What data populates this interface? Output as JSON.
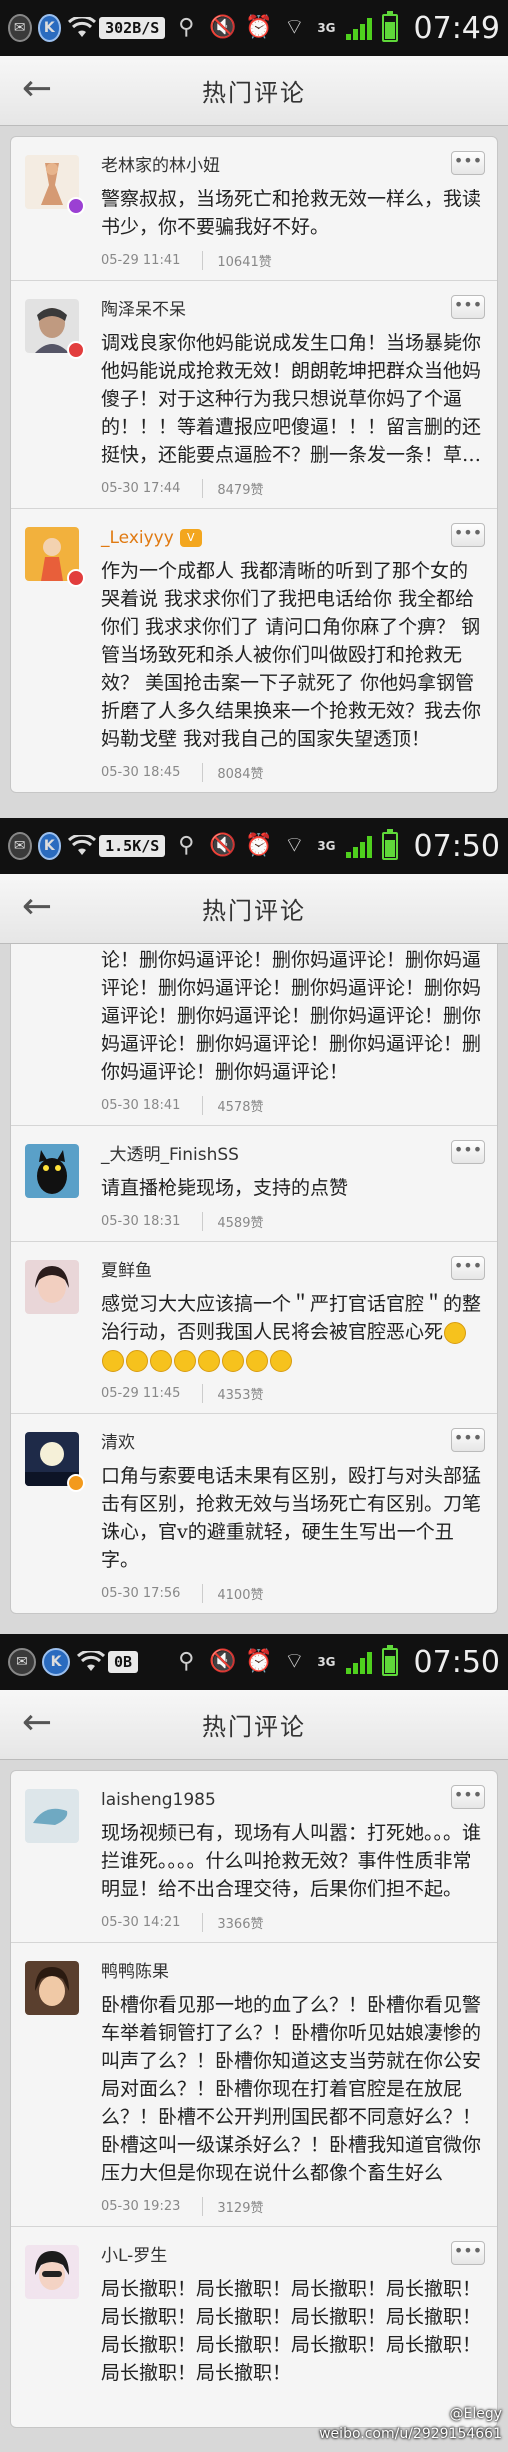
{
  "screens": [
    {
      "status": {
        "speed": "302B/S",
        "network": "3G",
        "time": "07:49"
      },
      "header": {
        "title": "热门评论"
      },
      "comments": [
        {
          "username": "老林家的林小妞",
          "content": "警察叔叔，当场死亡和抢救无效一样么，我读书少，你不要骗我好不好。",
          "date": "05-29 11:41",
          "likes": "10641赞"
        },
        {
          "username": "陶泽呆不呆",
          "content": "调戏良家你他妈能说成发生口角！当场暴毙你他妈能说成抢救无效！朗朗乾坤把群众当他妈傻子！对于这种行为我只想说草你妈了个逼的！！！等着遭报应吧傻逼！！！留言删的还挺快，还能要点逼脸不？删一条发一条！草…",
          "date": "05-30 17:44",
          "likes": "8479赞"
        },
        {
          "username": "_Lexiyyy",
          "level": "V",
          "content": "作为一个成都人 我都清晰的听到了那个女的哭着说 我求求你们了我把电话给你 我全都给你们 我求求你们了 请问口角你麻了个痹？ 钢管当场致死和杀人被你们叫做殴打和抢救无效？ 美国抢击案一下子就死了 你他妈拿钢管折磨了人多久结果换来一个抢救无效？我去你妈勒戈壁 我对我自己的国家失望透顶！",
          "date": "05-30 18:45",
          "likes": "8084赞"
        }
      ]
    },
    {
      "status": {
        "speed": "1.5K/S",
        "network": "3G",
        "time": "07:50"
      },
      "header": {
        "title": "热门评论"
      },
      "comments": [
        {
          "username": "",
          "content": "论！删你妈逼评论！删你妈逼评论！删你妈逼评论！删你妈逼评论！删你妈逼评论！删你妈逼评论！删你妈逼评论！删你妈逼评论！删你妈逼评论！删你妈逼评论！删你妈逼评论！删你妈逼评论！删你妈逼评论！",
          "date": "05-30 18:41",
          "likes": "4578赞"
        },
        {
          "username": "_大透明_FinishSS",
          "content": "请直播枪毙现场，支持的点赞",
          "date": "05-30 18:31",
          "likes": "4589赞"
        },
        {
          "username": "夏鲜鱼",
          "content": "感觉习大大应该搞一个＂严打官话官腔＂的整治行动，否则我国人民将会被官腔恶心死",
          "date": "05-29 11:45",
          "likes": "4353赞"
        },
        {
          "username": "清欢",
          "content": "口角与索要电话未果有区别，殴打与对头部猛击有区别，抢救无效与当场死亡有区别。刀笔诛心，官v的避重就轻，硬生生写出一个丑字。",
          "date": "05-30 17:56",
          "likes": "4100赞"
        }
      ]
    },
    {
      "status": {
        "speed": "0B",
        "network": "3G",
        "time": "07:50"
      },
      "header": {
        "title": "热门评论"
      },
      "comments": [
        {
          "username": "laisheng1985",
          "content": "现场视频已有，现场有人叫嚣：打死她。。。谁拦谁死。。。。什么叫抢救无效？事件性质非常明显！给不出合理交待，后果你们担不起。",
          "date": "05-30 14:21",
          "likes": "3366赞"
        },
        {
          "username": "鸭鸭陈果",
          "content": "卧槽你看见那一地的血了么？！卧槽你看见警车举着铜管打了么？！卧槽你听见姑娘凄惨的叫声了么？！卧槽你知道这支当劳就在你公安局对面么？！卧槽你现在打着官腔是在放屁么？！卧槽不公开判刑国民都不同意好么？！卧槽这叫一级谋杀好么？！卧槽我知道官微你压力大但是你现在说什么都像个畜生好么",
          "date": "05-30 19:23",
          "likes": "3129赞"
        },
        {
          "username": "小L-罗生",
          "content": "局长撤职！局长撤职！局长撤职！局长撤职！局长撤职！局长撤职！局长撤职！局长撤职！局长撤职！局长撤职！局长撤职！局长撤职！局长撤职！局长撤职！",
          "date": "",
          "likes": ""
        }
      ]
    }
  ],
  "watermark": {
    "line1": "@Elegy",
    "line2": "weibo.com/u/2929154661"
  },
  "colors": {
    "statusbar": "#111111",
    "signal": "#4fd01e",
    "vbadge_red": "#e23d3d",
    "vbadge_orange": "#f39a1c",
    "username_orange": "#e07a12"
  }
}
